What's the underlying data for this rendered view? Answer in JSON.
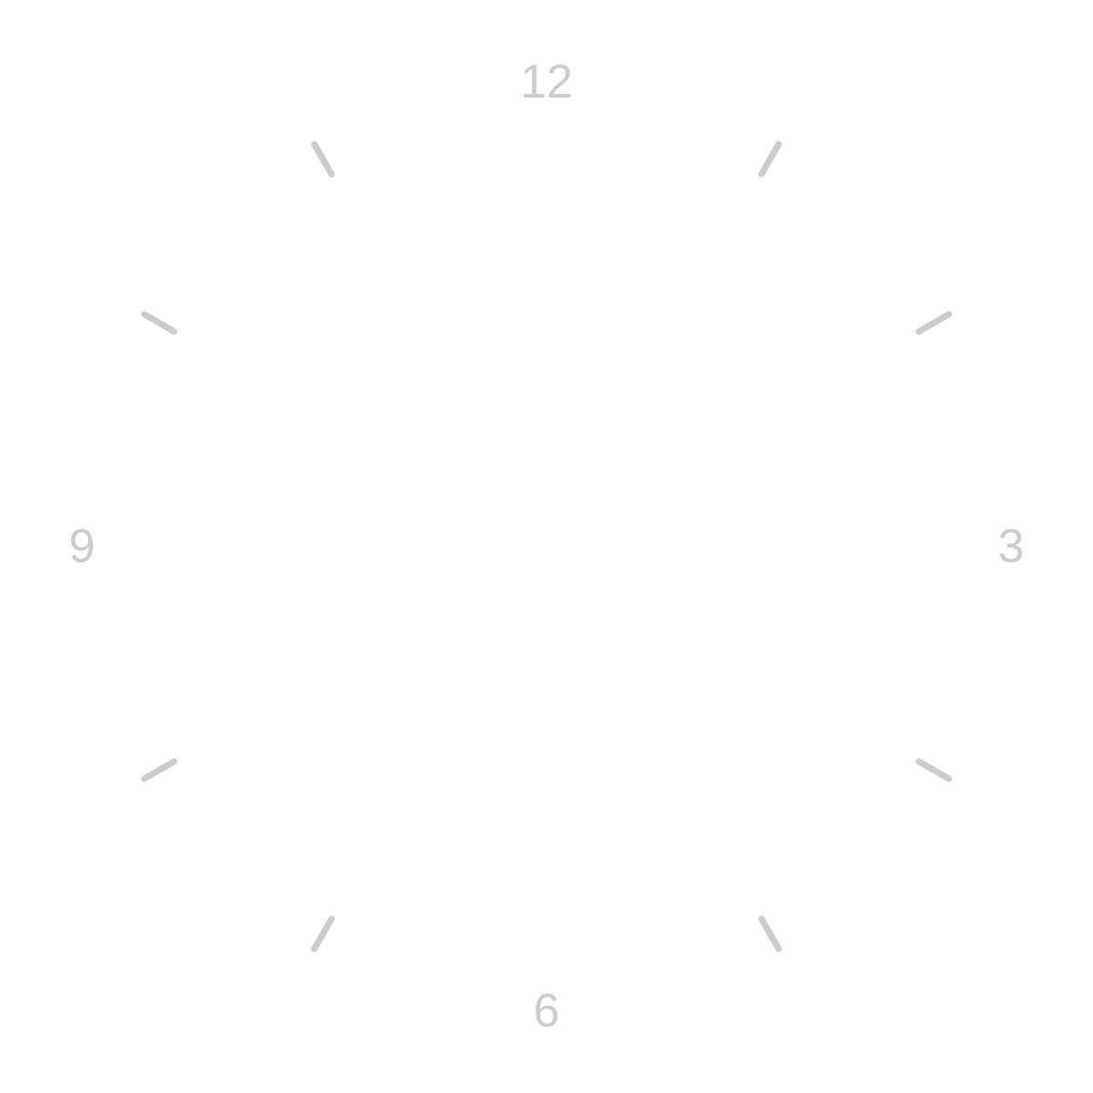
{
  "clock": {
    "mark_color": "#cccccc",
    "background_color": "#ffffff",
    "numerals": {
      "n12": "12",
      "n3": "3",
      "n6": "6",
      "n9": "9"
    },
    "tick_hours": [
      1,
      2,
      4,
      5,
      7,
      8,
      10,
      11
    ]
  }
}
